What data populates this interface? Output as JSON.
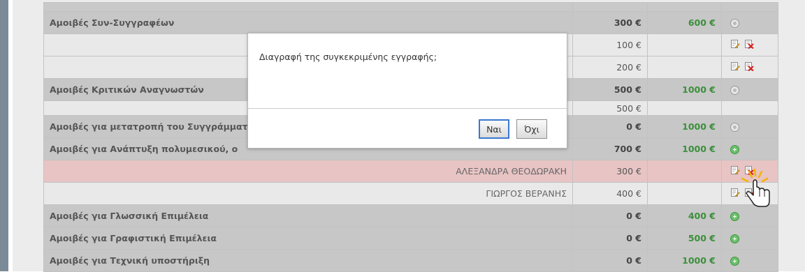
{
  "table": {
    "rows": [
      {
        "type": "cat",
        "name": "Αμοιβές Συν-Συγγραφέων",
        "amount": "300 €",
        "total": "600 €",
        "action": "grey"
      },
      {
        "type": "sub",
        "name": "",
        "amount": "100 €",
        "action": "edit-delete"
      },
      {
        "type": "sub",
        "name": "",
        "amount": "200 €",
        "action": "edit-delete"
      },
      {
        "type": "cat",
        "name": "Αμοιβές Κριτικών Αναγνωστών",
        "amount": "500 €",
        "total": "1000 €",
        "action": "grey"
      },
      {
        "type": "sub",
        "name": "",
        "amount": "500 €",
        "action": "none"
      },
      {
        "type": "cat",
        "name": "Αμοιβές για μετατροπή του Συγγράμματος",
        "amount": "0 €",
        "total": "1000 €",
        "action": "grey"
      },
      {
        "type": "cat",
        "name": "Αμοιβές για Ανάπτυξη πολυμεσικού, ο",
        "amount": "700 €",
        "total": "1000 €",
        "action": "green"
      },
      {
        "type": "sub",
        "name": "ΑΛΕΞΑΝΔΡΑ ΘΕΟΔΩΡΑΚΗ",
        "amount": "300 €",
        "action": "edit-delete",
        "highlight": true
      },
      {
        "type": "sub",
        "name": "ΓΙΩΡΓΟΣ ΒΕΡΑΝΗΣ",
        "amount": "400 €",
        "action": "edit-delete"
      },
      {
        "type": "cat",
        "name": "Αμοιβές για Γλωσσική Επιμέλεια",
        "amount": "0 €",
        "total": "400 €",
        "action": "green"
      },
      {
        "type": "cat",
        "name": "Αμοιβές για Γραφιστική Επιμέλεια",
        "amount": "0 €",
        "total": "500 €",
        "action": "green"
      },
      {
        "type": "cat",
        "name": "Αμοιβές για Τεχνική υποστήριξη",
        "amount": "0 €",
        "total": "1000 €",
        "action": "green"
      }
    ]
  },
  "dialog": {
    "message": "Διαγραφή της συγκεκριμένης εγγραφής;",
    "yes_label": "Ναι",
    "no_label": "Όχι"
  },
  "icons": {
    "edit": "edit-icon",
    "delete": "delete-icon",
    "expand_disabled": "circle-disabled-icon",
    "add": "add-circle-icon",
    "cursor": "hand-cursor-icon"
  },
  "colors": {
    "total_text": "#3c8f3c",
    "highlight_row": "#e8c4c4",
    "dialog_accent": "#3a78d1"
  }
}
